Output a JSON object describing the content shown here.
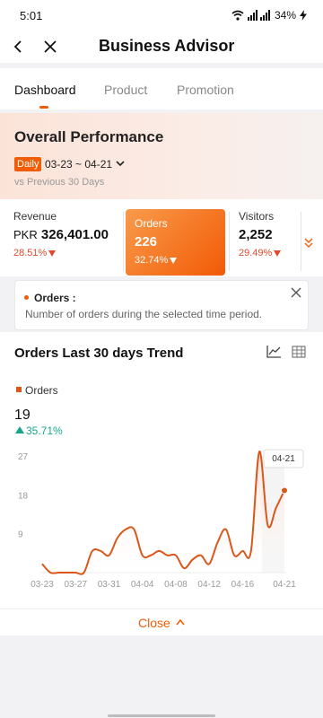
{
  "status_bar": {
    "time": "5:01",
    "battery": "34%"
  },
  "header": {
    "title": "Business Advisor"
  },
  "tabs": [
    {
      "label": "Dashboard",
      "active": true
    },
    {
      "label": "Product",
      "active": false
    },
    {
      "label": "Promotion",
      "active": false
    }
  ],
  "performance": {
    "title": "Overall Performance",
    "period_badge": "Daily",
    "date_range": "03-23 ~ 04-21",
    "comparison": "vs Previous 30 Days"
  },
  "metrics": [
    {
      "label": "Revenue",
      "currency": "PKR",
      "value": "326,401.00",
      "change": "28.51%",
      "direction": "down"
    },
    {
      "label": "Orders",
      "value": "226",
      "change": "32.74%",
      "direction": "down",
      "selected": true
    },
    {
      "label": "Visitors",
      "value": "2,252",
      "change": "29.49%",
      "direction": "down"
    }
  ],
  "info": {
    "title": "Orders :",
    "description": "Number of orders during the selected time period."
  },
  "trend": {
    "title": "Orders Last 30 days Trend",
    "legend": "Orders",
    "value": "19",
    "change": "35.71%",
    "tooltip": "04-21"
  },
  "chart_data": {
    "type": "area",
    "series": [
      {
        "name": "Orders",
        "values": [
          2,
          0,
          0,
          0,
          0,
          0,
          5,
          5,
          4,
          8,
          10,
          10,
          4,
          4,
          5,
          4,
          4,
          1,
          3,
          4,
          2,
          7,
          10,
          4,
          5,
          5,
          28,
          11,
          15,
          19
        ]
      }
    ],
    "x": [
      "03-23",
      "03-24",
      "03-25",
      "03-26",
      "03-27",
      "03-28",
      "03-29",
      "03-30",
      "03-31",
      "04-01",
      "04-02",
      "04-03",
      "04-04",
      "04-05",
      "04-06",
      "04-07",
      "04-08",
      "04-09",
      "04-10",
      "04-11",
      "04-12",
      "04-13",
      "04-14",
      "04-15",
      "04-16",
      "04-17",
      "04-18",
      "04-19",
      "04-20",
      "04-21"
    ],
    "x_ticks": [
      "03-23",
      "03-27",
      "03-31",
      "04-04",
      "04-08",
      "04-12",
      "04-16",
      "04-21"
    ],
    "y_ticks": [
      "9",
      "18",
      "27"
    ],
    "ylim": [
      0,
      27
    ],
    "grid": false,
    "colors": {
      "line": "#d9571b",
      "fill": "#fbe2d6",
      "marker": "#d9571b"
    }
  },
  "close_label": "Close",
  "colors": {
    "accent": "#f25c05",
    "down": "#e04b2c",
    "up": "#18a58c"
  }
}
